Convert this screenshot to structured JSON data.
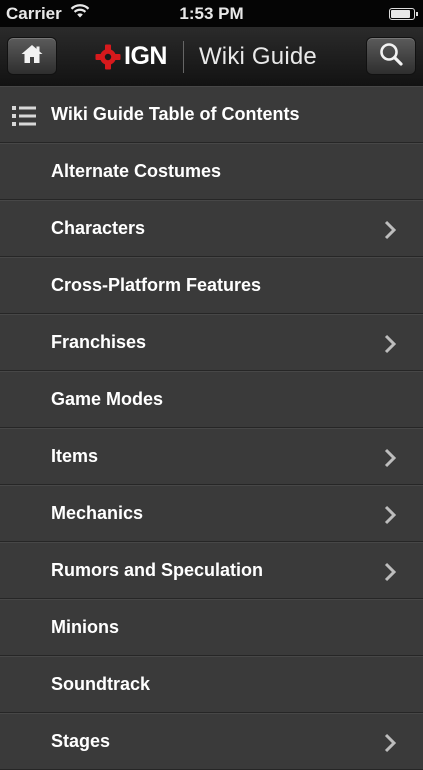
{
  "status_bar": {
    "carrier": "Carrier",
    "time": "1:53 PM",
    "signal_icon": "wifi-icon",
    "battery_icon": "battery-icon"
  },
  "nav": {
    "home_icon": "home-icon",
    "logo_text": "IGN",
    "title": "Wiki Guide",
    "search_icon": "search-icon"
  },
  "list": {
    "header": "Wiki Guide Table of Contents",
    "items": [
      {
        "label": "Alternate Costumes",
        "has_children": false
      },
      {
        "label": "Characters",
        "has_children": true
      },
      {
        "label": "Cross-Platform Features",
        "has_children": false
      },
      {
        "label": "Franchises",
        "has_children": true
      },
      {
        "label": "Game Modes",
        "has_children": false
      },
      {
        "label": "Items",
        "has_children": true
      },
      {
        "label": "Mechanics",
        "has_children": true
      },
      {
        "label": "Rumors and Speculation",
        "has_children": true
      },
      {
        "label": "Minions",
        "has_children": false
      },
      {
        "label": "Soundtrack",
        "has_children": false
      },
      {
        "label": "Stages",
        "has_children": true
      }
    ]
  },
  "colors": {
    "background": "#3a3a3a",
    "ign_red": "#d7191c",
    "text": "#ffffff"
  }
}
